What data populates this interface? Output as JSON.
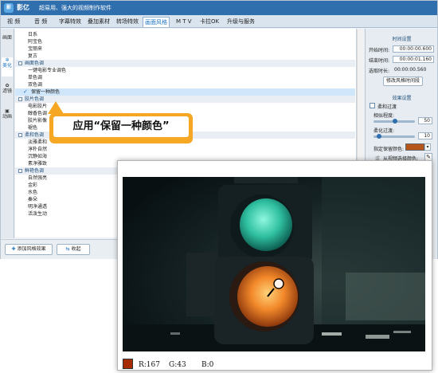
{
  "app": {
    "logo_text": "影",
    "name": "影亿",
    "subtitle": "超易用、强大的视频制作软件"
  },
  "menu": {
    "tabs": [
      "视  频",
      "音  频",
      "字幕特效",
      "叠加素材",
      "转场特效",
      "画面风格",
      "M T V",
      "卡拉OK",
      "升级与服务"
    ],
    "active_tab": "画面风格"
  },
  "sidebar": {
    "items": [
      "画面",
      "美化",
      "滤镜",
      "动画"
    ],
    "active": "美化"
  },
  "list": {
    "rows": [
      {
        "type": "item",
        "label": "日系"
      },
      {
        "type": "item",
        "label": "阿宝色"
      },
      {
        "type": "item",
        "label": "宝丽来"
      },
      {
        "type": "item",
        "label": "复古"
      },
      {
        "type": "cat",
        "label": "画面色调"
      },
      {
        "type": "item",
        "label": "一键电影专业调色"
      },
      {
        "type": "item",
        "label": "单色调"
      },
      {
        "type": "item",
        "label": "双色调"
      },
      {
        "type": "selected",
        "label": "保留一种颜色"
      },
      {
        "type": "cat",
        "label": "胶片色调"
      },
      {
        "type": "item",
        "label": "电影胶片"
      },
      {
        "type": "item",
        "label": "醇香色调"
      },
      {
        "type": "item",
        "label": "胶片影像"
      },
      {
        "type": "item",
        "label": "褪色"
      },
      {
        "type": "cat",
        "label": "柔和色调"
      },
      {
        "type": "item",
        "label": "淡雅柔和"
      },
      {
        "type": "item",
        "label": "淳朴自然"
      },
      {
        "type": "item",
        "label": "沉静如海"
      },
      {
        "type": "item",
        "label": "素净雅致"
      },
      {
        "type": "cat",
        "label": "鲜艳色调"
      },
      {
        "type": "item",
        "label": "自然强亮"
      },
      {
        "type": "item",
        "label": "金彩"
      },
      {
        "type": "item",
        "label": "水色"
      },
      {
        "type": "item",
        "label": "秦朵"
      },
      {
        "type": "item",
        "label": "明净通透"
      },
      {
        "type": "item",
        "label": "活泼生动"
      }
    ]
  },
  "bottom": {
    "add_button": "添加风格效果",
    "collapse_button": "收起"
  },
  "right_panel": {
    "time_section": "时间设置",
    "start_label": "开始时间:",
    "start_value": "00:00:00.600",
    "end_label": "结束时间:",
    "end_value": "00:00:01.160",
    "duration_label": "选取时长:",
    "duration_value": "00:00:00.560",
    "modify_button": "修改风格时间段",
    "effect_section": "效果设置",
    "soft_transition_label": "柔和过渡",
    "similarity_label": "相似程度:",
    "similarity_value": "50",
    "softness_label": "柔化过渡:",
    "softness_value": "10",
    "keep_color_label": "指定保留颜色:",
    "keep_color_hex": "#b5561c",
    "pick_label": "从视频选择颜色:"
  },
  "callout": {
    "text": "应用“保留一种颜色”",
    "color": "#f6a723"
  },
  "preview": {
    "swatch_color": "#a72b00",
    "r_text": "R:167",
    "g_text": "G:43",
    "b_text": "B:0"
  }
}
